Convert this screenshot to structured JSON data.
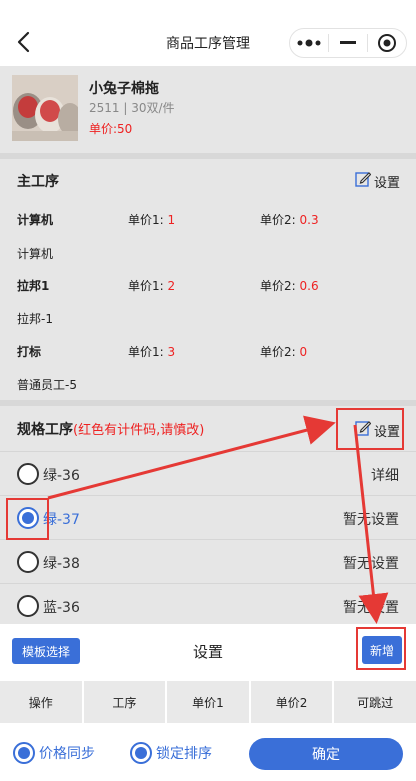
{
  "header": {
    "title": "商品工序管理"
  },
  "product": {
    "name": "小兔子棉拖",
    "code_line": "2511 | 30双/件",
    "price": "单价:50"
  },
  "main_process": {
    "title": "主工序",
    "setting_label": "设置",
    "rows": [
      {
        "name": "计算机",
        "price1_label": "单价1:",
        "price1": "1",
        "price2_label": "单价2:",
        "price2": "0.3",
        "worker": "计算机"
      },
      {
        "name": "拉邦1",
        "price1_label": "单价1:",
        "price1": "2",
        "price2_label": "单价2:",
        "price2": "0.6",
        "worker": "拉邦-1"
      },
      {
        "name": "打标",
        "price1_label": "单价1:",
        "price1": "3",
        "price2_label": "单价2:",
        "price2": "0",
        "worker": "普通员工-5"
      }
    ]
  },
  "spec_process": {
    "title": "规格工序",
    "note": "(红色有计件码,请慎改)",
    "setting_label": "设置",
    "items": [
      {
        "label": "绿-36",
        "status": "详细",
        "checked": false,
        "status_red": false
      },
      {
        "label": "绿-37",
        "status": "暂无设置",
        "checked": true,
        "status_red": true
      },
      {
        "label": "绿-38",
        "status": "暂无设置",
        "checked": false,
        "status_red": false
      },
      {
        "label": "蓝-36",
        "status": "暂无设置",
        "checked": false,
        "status_red": false
      }
    ]
  },
  "panel": {
    "template_button": "模板选择",
    "title": "设置",
    "add_button": "新增"
  },
  "table": {
    "headers": [
      "操作",
      "工序",
      "单价1",
      "单价2",
      "可跳过"
    ]
  },
  "footer": {
    "price_sync": "价格同步",
    "lock_sort": "锁定排序",
    "confirm": "确定"
  },
  "colors": {
    "accent": "#3a6fd8",
    "danger": "#e22222",
    "annotation": "#e53935"
  }
}
